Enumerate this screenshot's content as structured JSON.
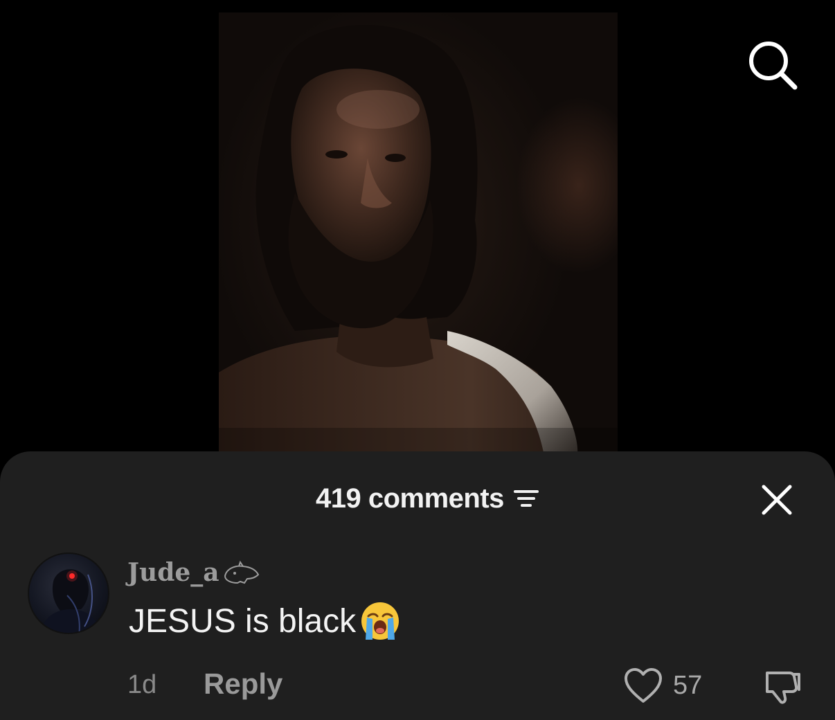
{
  "icons": {
    "search": "search-icon",
    "sort": "sort-filter-icon",
    "close": "close-icon",
    "like": "heart-icon",
    "dislike": "thumbs-down-icon",
    "emoji": "loudly-crying-face-emoji"
  },
  "comments_header": {
    "count_label": "419 comments"
  },
  "comment": {
    "username": "Jude_a",
    "text": "JESUS is black",
    "time": "1d",
    "reply_label": "Reply",
    "like_count": "57"
  },
  "colors": {
    "background": "#000000",
    "sheet": "#1f1f1f",
    "primary_text": "#f4f4f4",
    "secondary_text": "#8a8a8a"
  }
}
